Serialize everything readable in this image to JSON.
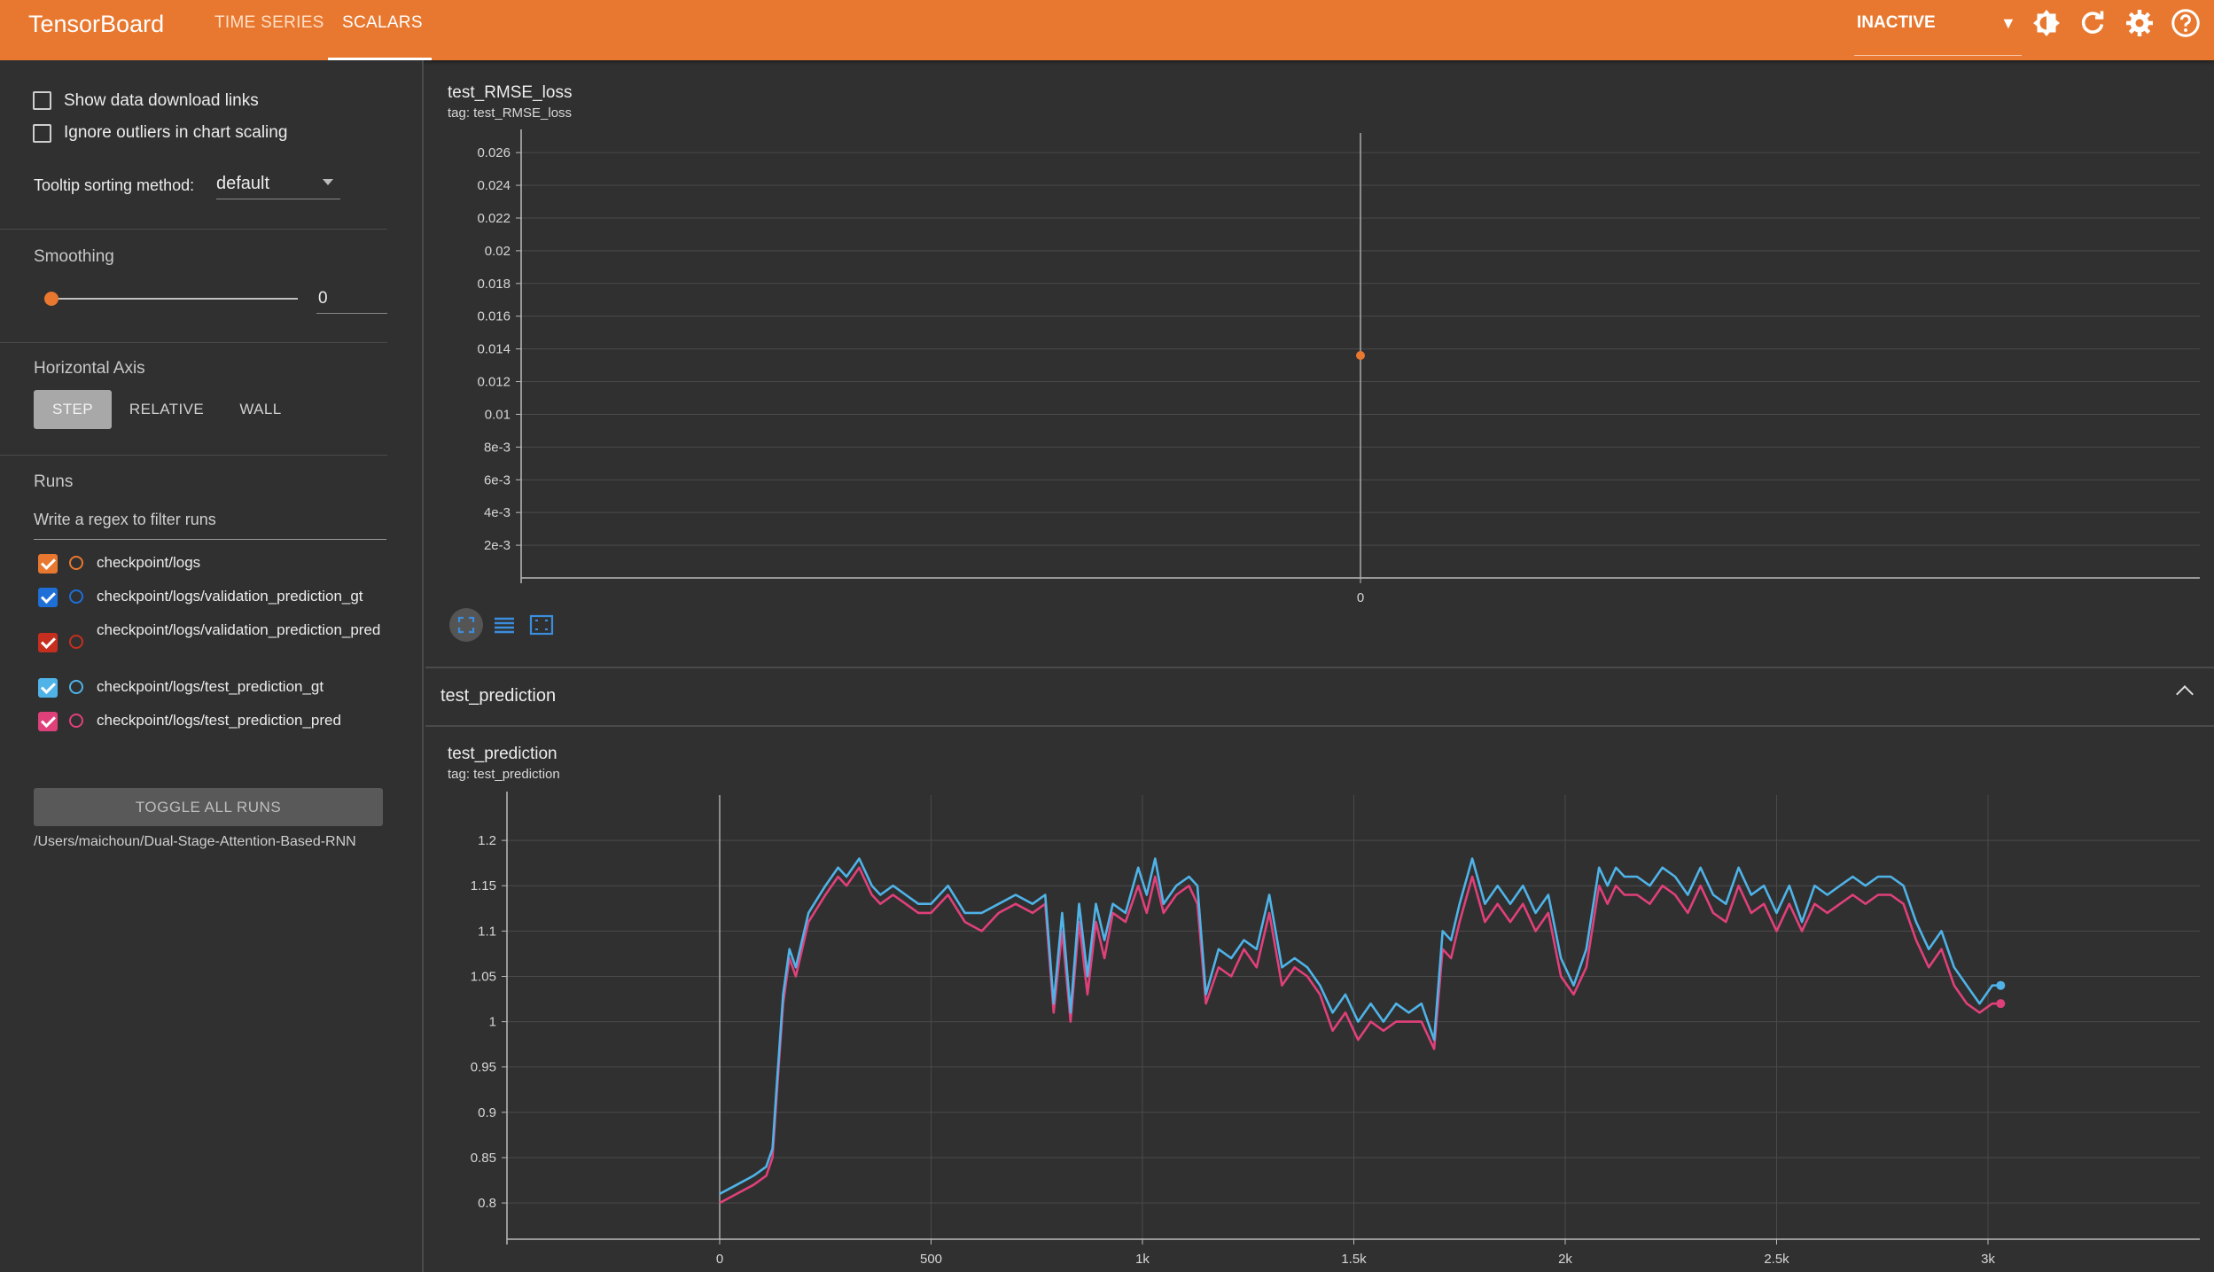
{
  "app": {
    "title": "TensorBoard"
  },
  "nav": {
    "tabs": [
      {
        "label": "TIME SERIES"
      },
      {
        "label": "SCALARS"
      }
    ],
    "status": "INACTIVE"
  },
  "sidebar": {
    "show_download_links": "Show data download links",
    "ignore_outliers": "Ignore outliers in chart scaling",
    "tooltip_label": "Tooltip sorting method:",
    "tooltip_value": "default",
    "smoothing_label": "Smoothing",
    "smoothing_value": "0",
    "smoothing_level": 0,
    "horizontal_axis_label": "Horizontal Axis",
    "axis_options": [
      "STEP",
      "RELATIVE",
      "WALL"
    ],
    "runs_label": "Runs",
    "filter_placeholder": "Write a regex to filter runs",
    "runs": [
      {
        "name": "checkpoint/logs",
        "color": "#e8782f",
        "checked": true
      },
      {
        "name": "checkpoint/logs/validation_prediction_gt",
        "color": "#1e6fd6",
        "checked": true
      },
      {
        "name": "checkpoint/logs/validation_prediction_pred",
        "color": "#c62f1f",
        "checked": true
      },
      {
        "name": "checkpoint/logs/test_prediction_gt",
        "color": "#4fb3e8",
        "checked": true
      },
      {
        "name": "checkpoint/logs/test_prediction_pred",
        "color": "#e0407a",
        "checked": true
      }
    ],
    "toggle_all": "TOGGLE ALL RUNS",
    "logdir": "/Users/maichoun/Dual-Stage-Attention-Based-RNN"
  },
  "cards": {
    "rmse": {
      "title": "test_RMSE_loss",
      "tag": "tag: test_RMSE_loss"
    },
    "section": {
      "title": "test_prediction"
    },
    "pred": {
      "title": "test_prediction",
      "tag": "tag: test_prediction"
    }
  },
  "chart_data": [
    {
      "type": "scatter",
      "title": "test_RMSE_loss",
      "x_ticks": [
        "0"
      ],
      "y_ticks": [
        "2e-3",
        "4e-3",
        "6e-3",
        "8e-3",
        "0.01",
        "0.012",
        "0.014",
        "0.016",
        "0.018",
        "0.02",
        "0.022",
        "0.024",
        "0.026"
      ],
      "ylim": [
        0,
        0.0272
      ],
      "series": [
        {
          "name": "checkpoint/logs",
          "color": "#e8782f",
          "points": [
            {
              "x": 0,
              "y": 0.0136
            }
          ]
        }
      ]
    },
    {
      "type": "line",
      "title": "test_prediction",
      "x_ticks": [
        "0",
        "500",
        "1k",
        "1.5k",
        "2k",
        "2.5k",
        "3k"
      ],
      "y_ticks": [
        "0.8",
        "0.85",
        "0.9",
        "0.95",
        "1",
        "1.05",
        "1.1",
        "1.15",
        "1.2"
      ],
      "xlim": [
        -500,
        3500
      ],
      "ylim": [
        0.76,
        1.25
      ],
      "x": [
        0,
        40,
        80,
        110,
        125,
        135,
        150,
        165,
        180,
        210,
        250,
        280,
        300,
        330,
        360,
        380,
        410,
        440,
        470,
        500,
        540,
        580,
        620,
        660,
        700,
        740,
        770,
        790,
        810,
        830,
        850,
        870,
        890,
        910,
        930,
        960,
        990,
        1010,
        1030,
        1050,
        1080,
        1110,
        1130,
        1150,
        1180,
        1210,
        1240,
        1270,
        1300,
        1330,
        1360,
        1390,
        1420,
        1450,
        1480,
        1510,
        1540,
        1570,
        1600,
        1630,
        1660,
        1690,
        1710,
        1730,
        1750,
        1780,
        1810,
        1840,
        1870,
        1900,
        1930,
        1960,
        1990,
        2020,
        2050,
        2080,
        2100,
        2120,
        2140,
        2170,
        2200,
        2230,
        2260,
        2290,
        2320,
        2350,
        2380,
        2410,
        2440,
        2470,
        2500,
        2530,
        2560,
        2590,
        2620,
        2650,
        2680,
        2710,
        2740,
        2770,
        2800,
        2830,
        2860,
        2890,
        2920,
        2950,
        2980,
        3010,
        3030
      ],
      "series": [
        {
          "name": "checkpoint/logs/test_prediction_gt",
          "color": "#4fb3e8",
          "values": [
            0.81,
            0.82,
            0.83,
            0.84,
            0.86,
            0.93,
            1.03,
            1.08,
            1.06,
            1.12,
            1.15,
            1.17,
            1.16,
            1.18,
            1.15,
            1.14,
            1.15,
            1.14,
            1.13,
            1.13,
            1.15,
            1.12,
            1.12,
            1.13,
            1.14,
            1.13,
            1.14,
            1.02,
            1.12,
            1.01,
            1.13,
            1.05,
            1.13,
            1.09,
            1.13,
            1.12,
            1.17,
            1.14,
            1.18,
            1.13,
            1.15,
            1.16,
            1.15,
            1.03,
            1.08,
            1.07,
            1.09,
            1.08,
            1.14,
            1.06,
            1.07,
            1.06,
            1.04,
            1.01,
            1.03,
            1.0,
            1.02,
            1.0,
            1.02,
            1.01,
            1.02,
            0.98,
            1.1,
            1.09,
            1.13,
            1.18,
            1.13,
            1.15,
            1.13,
            1.15,
            1.12,
            1.14,
            1.07,
            1.04,
            1.08,
            1.17,
            1.15,
            1.17,
            1.16,
            1.16,
            1.15,
            1.17,
            1.16,
            1.14,
            1.17,
            1.14,
            1.13,
            1.17,
            1.14,
            1.15,
            1.12,
            1.15,
            1.11,
            1.15,
            1.14,
            1.15,
            1.16,
            1.15,
            1.16,
            1.16,
            1.15,
            1.11,
            1.08,
            1.1,
            1.06,
            1.04,
            1.02,
            1.04,
            1.04
          ]
        },
        {
          "name": "checkpoint/logs/test_prediction_pred",
          "color": "#e0407a",
          "values": [
            0.8,
            0.81,
            0.82,
            0.83,
            0.85,
            0.92,
            1.02,
            1.07,
            1.05,
            1.11,
            1.14,
            1.16,
            1.15,
            1.17,
            1.14,
            1.13,
            1.14,
            1.13,
            1.12,
            1.12,
            1.14,
            1.11,
            1.1,
            1.12,
            1.13,
            1.12,
            1.13,
            1.01,
            1.1,
            1.0,
            1.11,
            1.03,
            1.11,
            1.07,
            1.12,
            1.11,
            1.15,
            1.12,
            1.16,
            1.12,
            1.14,
            1.15,
            1.13,
            1.02,
            1.06,
            1.05,
            1.08,
            1.06,
            1.12,
            1.04,
            1.06,
            1.05,
            1.03,
            0.99,
            1.01,
            0.98,
            1.0,
            0.99,
            1.0,
            1.0,
            1.0,
            0.97,
            1.08,
            1.07,
            1.11,
            1.16,
            1.11,
            1.13,
            1.11,
            1.13,
            1.1,
            1.12,
            1.05,
            1.03,
            1.06,
            1.15,
            1.13,
            1.15,
            1.14,
            1.14,
            1.13,
            1.15,
            1.14,
            1.12,
            1.15,
            1.12,
            1.11,
            1.15,
            1.12,
            1.13,
            1.1,
            1.13,
            1.1,
            1.13,
            1.12,
            1.13,
            1.14,
            1.13,
            1.14,
            1.14,
            1.13,
            1.09,
            1.06,
            1.08,
            1.04,
            1.02,
            1.01,
            1.02,
            1.02
          ]
        }
      ]
    }
  ]
}
